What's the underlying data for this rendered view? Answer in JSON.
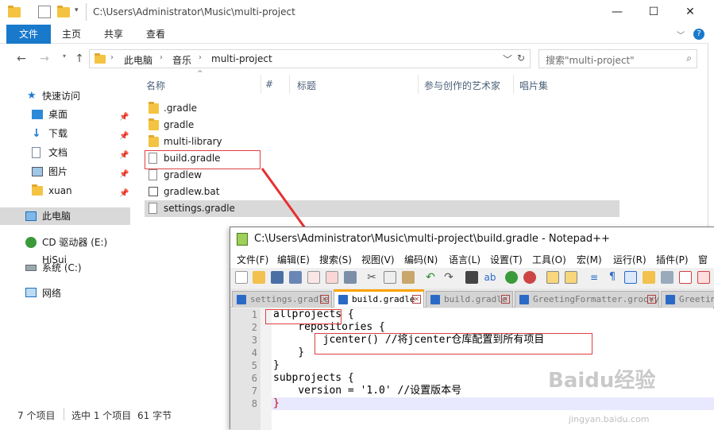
{
  "explorer": {
    "title_path": "C:\\Users\\Administrator\\Music\\multi-project",
    "ribbon_tabs": [
      "文件",
      "主页",
      "共享",
      "查看"
    ],
    "breadcrumb": [
      "此电脑",
      "音乐",
      "multi-project"
    ],
    "search_placeholder": "搜索\"multi-project\"",
    "nav": {
      "quick_access": "快速访问",
      "items": [
        "桌面",
        "下载",
        "文档",
        "图片",
        "xuan"
      ],
      "this_pc": "此电脑",
      "cd_drive": "CD 驱动器 (E:) HiSui",
      "system": "系统 (C:)",
      "network": "网络"
    },
    "columns": [
      "名称",
      "#",
      "标题",
      "参与创作的艺术家",
      "唱片集"
    ],
    "files": [
      ".gradle",
      "gradle",
      "multi-library",
      "build.gradle",
      "gradlew",
      "gradlew.bat",
      "settings.gradle"
    ],
    "status": {
      "items": "7 个项目",
      "selected": "选中 1 个项目",
      "size": "61 字节"
    }
  },
  "notepad": {
    "title": "C:\\Users\\Administrator\\Music\\multi-project\\build.gradle - Notepad++",
    "menu": [
      "文件(F)",
      "编辑(E)",
      "搜索(S)",
      "视图(V)",
      "编码(N)",
      "语言(L)",
      "设置(T)",
      "工具(O)",
      "宏(M)",
      "运行(R)",
      "插件(P)",
      "窗口"
    ],
    "tabs": [
      "settings.gradle",
      "build.gradle",
      "build.gradle",
      "GreetingFormatter.groovy",
      "Greeting"
    ],
    "line_numbers": [
      "1",
      "2",
      "3",
      "4",
      "5",
      "6",
      "7",
      "8"
    ],
    "code": [
      "allprojects {",
      "    repositories {",
      "        jcenter() //将jcenter仓库配置到所有项目",
      "    }",
      "}",
      "subprojects {",
      "    version = '1.0' //设置版本号",
      "}"
    ]
  },
  "watermark": {
    "logo": "Baidu经验",
    "url": "jingyan.baidu.com"
  }
}
